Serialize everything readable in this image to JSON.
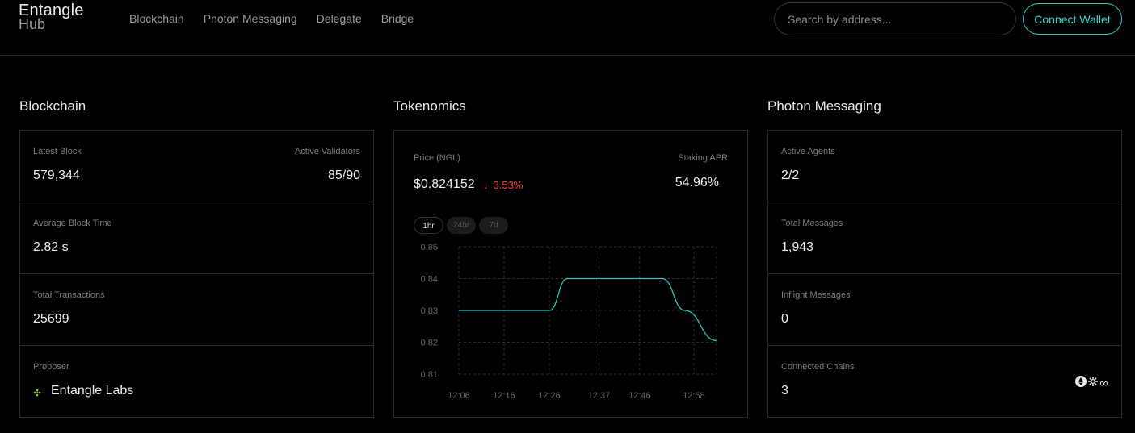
{
  "header": {
    "logo_line1": "Entangle",
    "logo_line2": "Hub",
    "nav": [
      "Blockchain",
      "Photon Messaging",
      "Delegate",
      "Bridge"
    ],
    "search_placeholder": "Search by address...",
    "connect_label": "Connect Wallet"
  },
  "blockchain": {
    "title": "Blockchain",
    "latest_block_label": "Latest Block",
    "latest_block": "579,344",
    "validators_label": "Active Validators",
    "validators": "85/90",
    "block_time_label": "Average Block Time",
    "block_time": "2.82 s",
    "transactions_label": "Total Transactions",
    "transactions": "25699",
    "proposer_label": "Proposer",
    "proposer": "Entangle Labs"
  },
  "tokenomics": {
    "title": "Tokenomics",
    "price_label": "Price (NGL)",
    "price": "$0.824152",
    "change": "3.53%",
    "apr_label": "Staking APR",
    "apr": "54.96%",
    "timeframes": [
      "1hr",
      "24hr",
      "7d"
    ],
    "active_timeframe": "1hr"
  },
  "photon": {
    "title": "Photon Messaging",
    "agents_label": "Active Agents",
    "agents": "2/2",
    "total_label": "Total Messages",
    "total": "1,943",
    "inflight_label": "Inflight Messages",
    "inflight": "0",
    "chains_label": "Connected Chains",
    "chains": "3",
    "chain_icons": [
      "ethereum-icon",
      "chain-icon",
      "infinity-icon"
    ]
  },
  "colors": {
    "accent": "#33d6cd",
    "negative": "#ff3a3a",
    "line": "#2fc4c0"
  },
  "chart_data": {
    "type": "line",
    "x": [
      "12:06",
      "12:16",
      "12:26",
      "12:37",
      "12:46",
      "12:58",
      "13:03"
    ],
    "xticks": [
      "12:06",
      "12:16",
      "12:26",
      "12:37",
      "12:46",
      "12:58"
    ],
    "series": [
      {
        "x": [
          "12:06",
          "12:10",
          "12:16",
          "12:20",
          "12:26",
          "12:30",
          "12:37",
          "12:42",
          "12:46",
          "12:51",
          "12:56",
          "13:03"
        ],
        "values": [
          0.83,
          0.83,
          0.83,
          0.83,
          0.83,
          0.84,
          0.84,
          0.84,
          0.84,
          0.84,
          0.83,
          0.8205
        ]
      }
    ],
    "yticks": [
      0.85,
      0.84,
      0.83,
      0.82,
      0.81
    ],
    "ylim": [
      0.81,
      0.85
    ],
    "grid": true
  }
}
